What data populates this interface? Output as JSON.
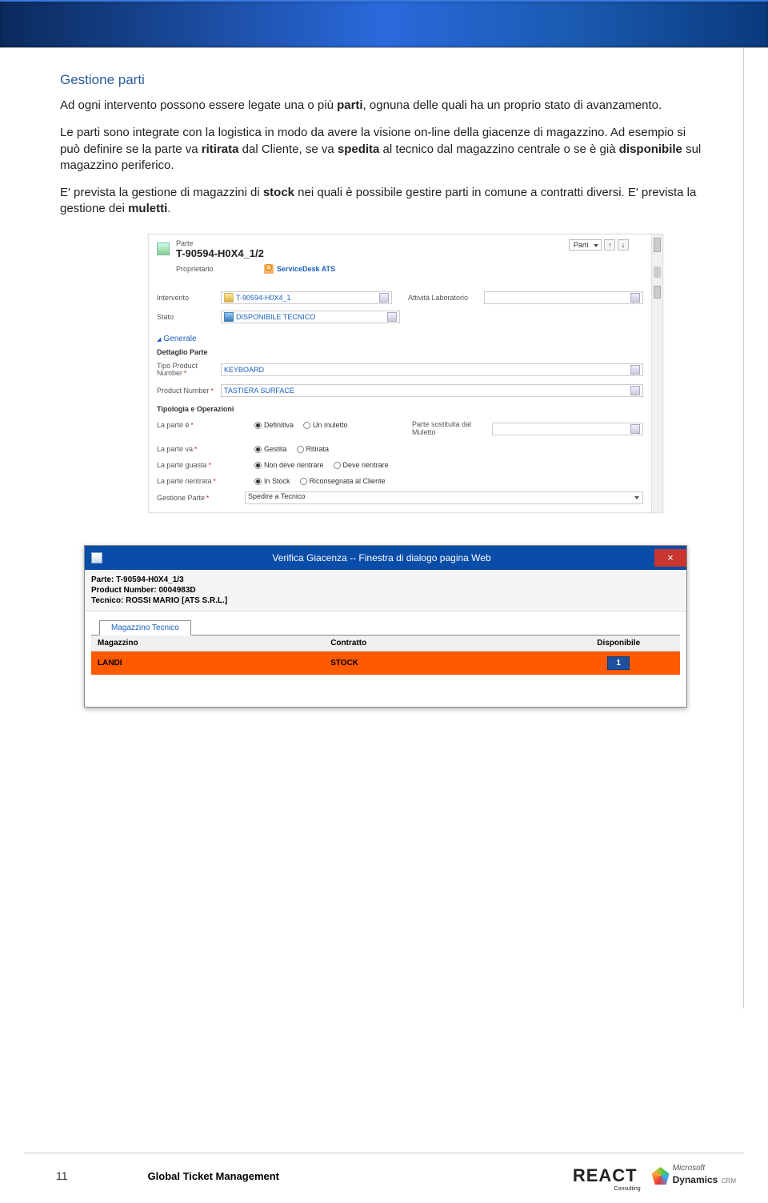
{
  "doc": {
    "heading": "Gestione parti",
    "p1_a": "Ad ogni intervento possono essere legate una o più ",
    "p1_b": "parti",
    "p1_c": ", ognuna delle quali ha un proprio stato di avanzamento.",
    "p2": "Le parti sono integrate con la logistica in modo da avere la visione on-line della giacenze di magazzino. Ad esempio si può definire se la parte va ",
    "p2_b1": "ritirata",
    "p2_m": " dal Cliente, se va ",
    "p2_b2": "spedita",
    "p2_m2": " al tecnico dal magazzino centrale o se è già ",
    "p2_b3": "disponibile",
    "p2_e": " sul magazzino periferico.",
    "p3_a": "E' prevista la gestione di magazzini di ",
    "p3_b": "stock",
    "p3_c": " nei quali è possibile gestire parti in comune a contratti diversi. E' prevista la gestione dei ",
    "p3_d": "muletti",
    "p3_e": "."
  },
  "crm": {
    "entity_label": "Parte",
    "record_title": "T-90594-H0X4_1/2",
    "related_dd": "Parti",
    "owner_label": "Proprietario",
    "owner_value": "ServiceDesk ATS",
    "fields": {
      "intervento_label": "Intervento",
      "intervento_value": "T-90594-H0X4_1",
      "attivita_label": "Attività Laboratorio",
      "attivita_value": "",
      "stato_label": "Stato",
      "stato_value": "DISPONIBILE TECNICO"
    },
    "section_generale": "Generale",
    "sub_dettaglio": "Dettaglio Parte",
    "tipo_pn_label": "Tipo Product Number",
    "tipo_pn_value": "KEYBOARD",
    "pn_label": "Product Number",
    "pn_value": "TASTIERA SURFACE",
    "sub_tipologia": "Tipologia e Operazioni",
    "radios": {
      "la_parte_e": {
        "label": "La parte è",
        "opt1": "Definitiva",
        "opt2": "Un muletto",
        "sel": 1
      },
      "parte_sost_label": "Parte sostituita dal Muletto",
      "la_parte_va": {
        "label": "La parte va",
        "opt1": "Gestita",
        "opt2": "Ritirata",
        "sel": 1
      },
      "la_parte_guasta": {
        "label": "La parte guasta",
        "opt1": "Non deve rientrare",
        "opt2": "Deve rientrare",
        "sel": 1
      },
      "la_parte_rientrata": {
        "label": "La parte rientrata",
        "opt1": "In Stock",
        "opt2": "Riconsegnata al Cliente",
        "sel": 1
      }
    },
    "gestione_parte_label": "Gestione Parte",
    "gestione_parte_value": "Spedire a Tecnico"
  },
  "dialog": {
    "title": "Verifica Giacenza -- Finestra di dialogo pagina Web",
    "parte_line": "Parte: T-90594-H0X4_1/3",
    "pn_line": "Product Number: 0004983D",
    "tecnico_line": "Tecnico: ROSSI MARIO [ATS S.R.L.]",
    "tab": "Magazzino Tecnico",
    "col_magazzino": "Magazzino",
    "col_contratto": "Contratto",
    "col_disponibile": "Disponibile",
    "row_magazzino": "LANDI",
    "row_contratto": "STOCK",
    "row_qty": "1"
  },
  "footer": {
    "page": "11",
    "title": "Global Ticket Management",
    "logo1": "REACT",
    "logo2a": "Microsoft",
    "logo2b": "Dynamics",
    "logo2c": "CRM"
  }
}
